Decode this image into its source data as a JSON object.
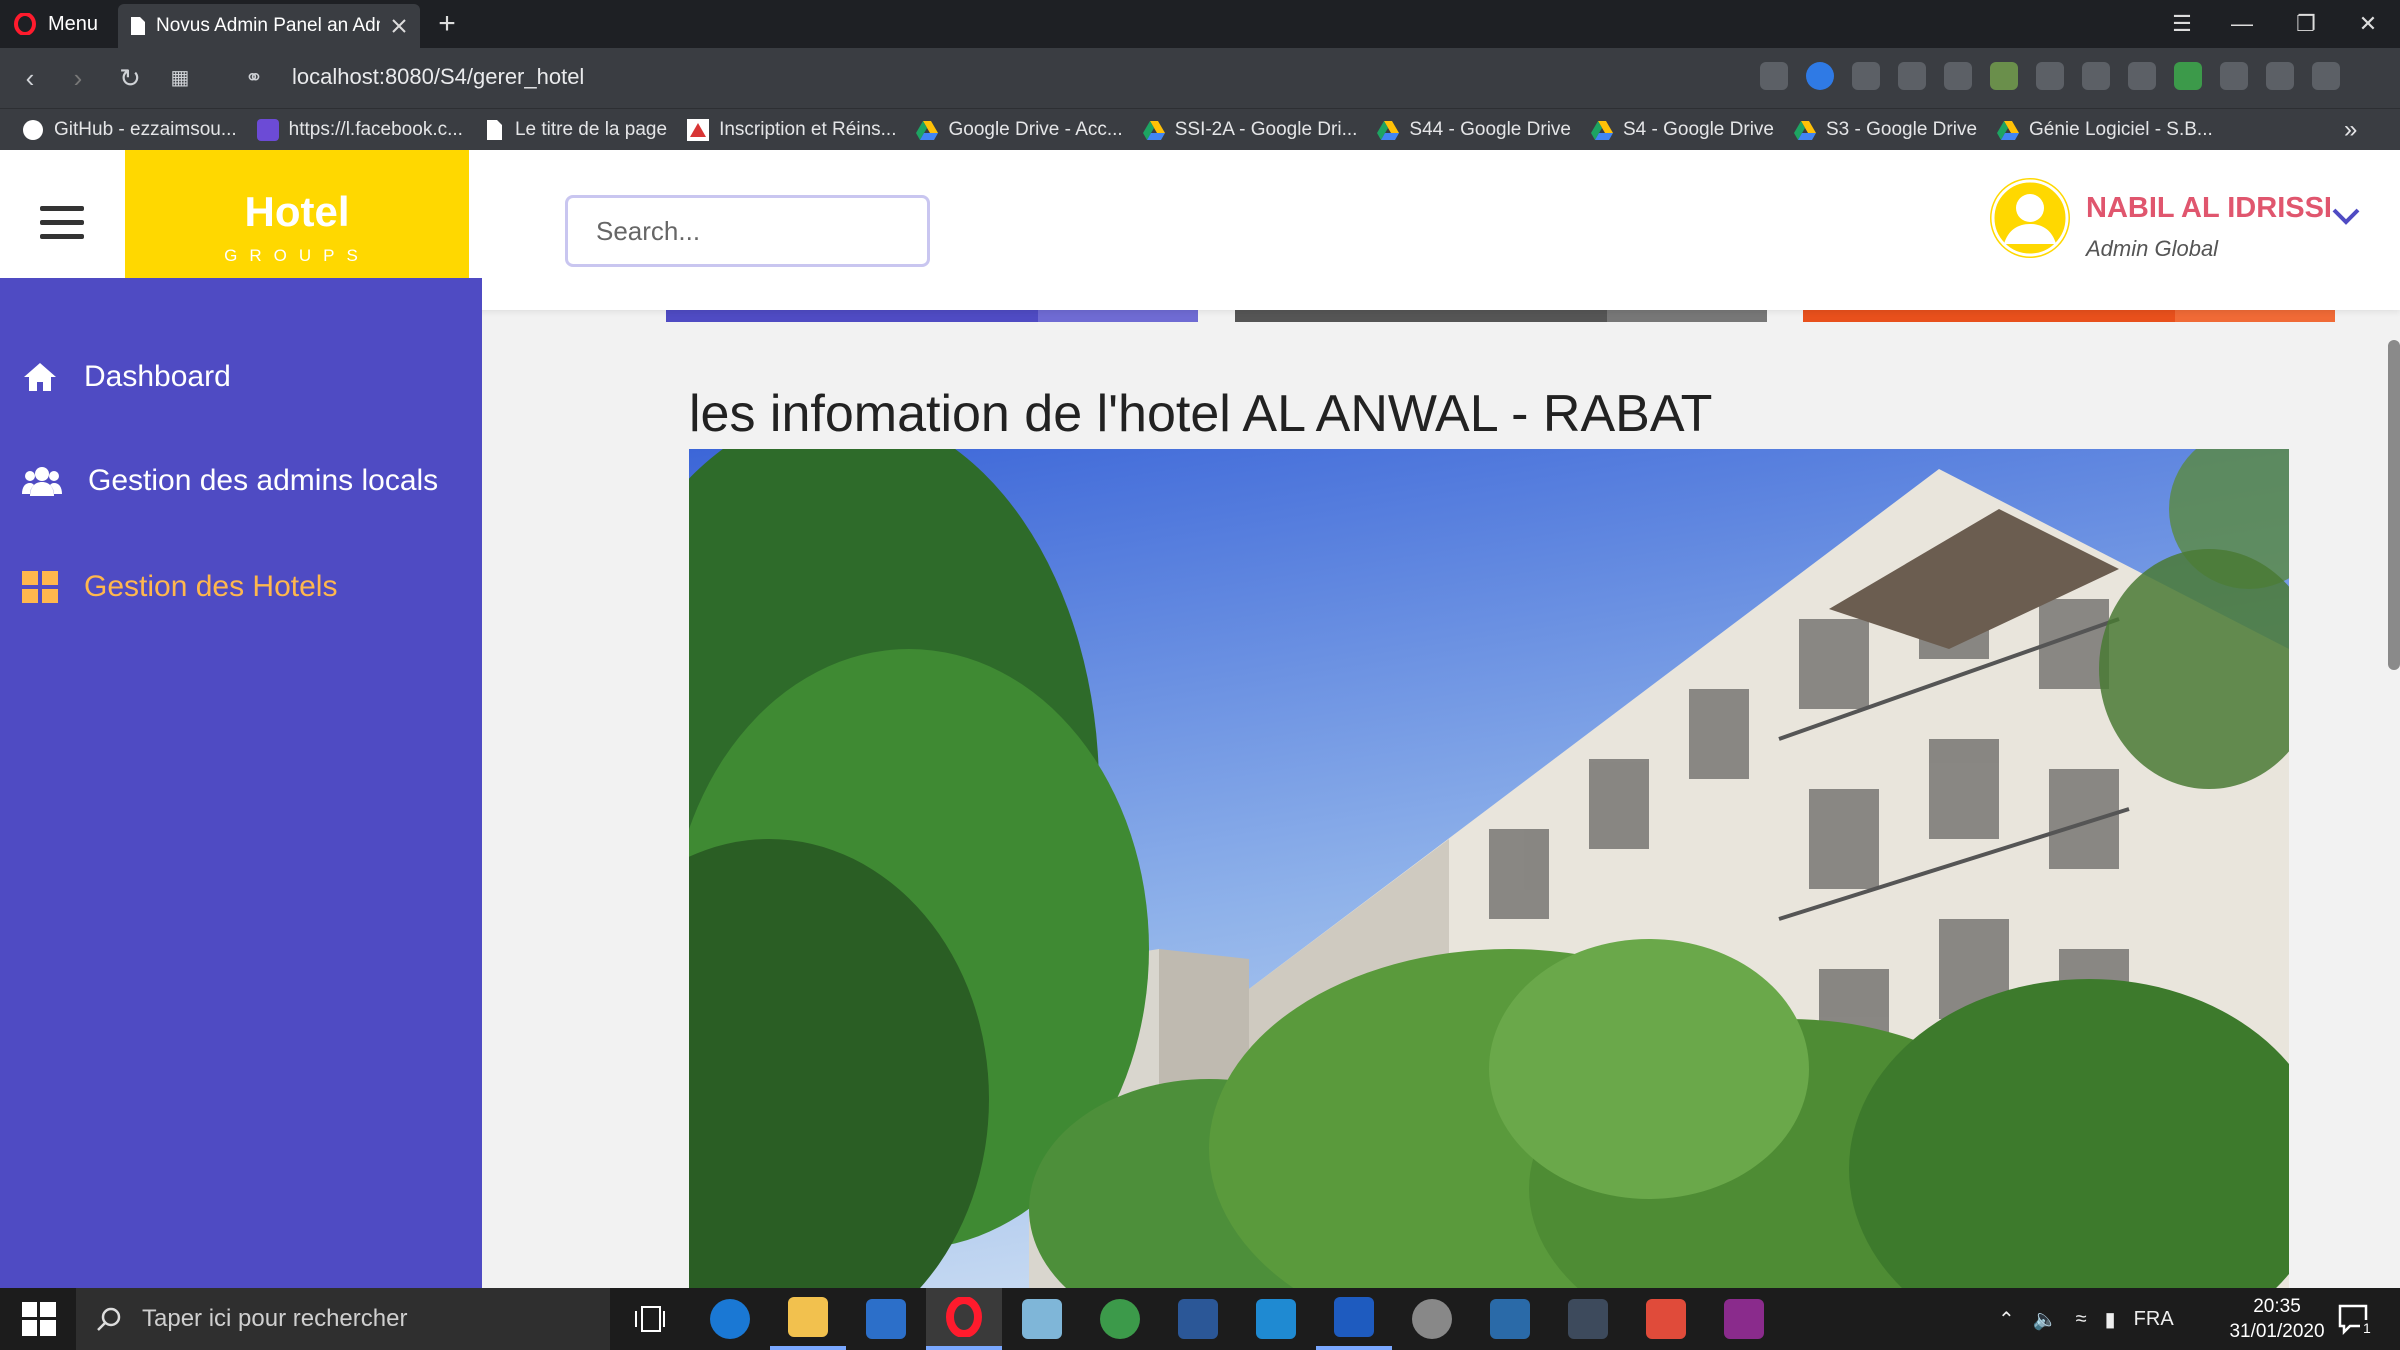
{
  "browser": {
    "menu_label": "Menu",
    "tab_title": "Novus Admin Panel an Adm",
    "url": "localhost:8080/S4/gerer_hotel",
    "bookmarks": [
      {
        "label": "GitHub - ezzaimsou..."
      },
      {
        "label": "https://l.facebook.c..."
      },
      {
        "label": "Le titre de la page"
      },
      {
        "label": "Inscription et Réins..."
      },
      {
        "label": "Google Drive - Acc..."
      },
      {
        "label": "SSI-2A - Google Dri..."
      },
      {
        "label": "S44 - Google Drive"
      },
      {
        "label": "S4 - Google Drive"
      },
      {
        "label": "S3 - Google Drive"
      },
      {
        "label": "Génie Logiciel - S.B..."
      }
    ]
  },
  "header": {
    "logo_title": "Hotel",
    "logo_subtitle": "GROUPS",
    "search_placeholder": "Search...",
    "user_name": "NABIL AL IDRISSI",
    "user_role": "Admin Global"
  },
  "sidebar": {
    "items": [
      {
        "label": "Dashboard",
        "icon": "home-icon",
        "active": false
      },
      {
        "label": "Gestion des admins locals",
        "icon": "users-icon",
        "active": false
      },
      {
        "label": "Gestion des Hotels",
        "icon": "grid-icon",
        "active": true
      }
    ]
  },
  "main": {
    "title": "les infomation de l'hotel AL ANWAL - RABAT",
    "image_alt": "hotel-building-photo",
    "cards": [
      {
        "color": "#4f4bc3",
        "progress": 0.7
      },
      {
        "color": "#555555",
        "progress": 0.7
      },
      {
        "color": "#e8501c",
        "progress": 0.7
      }
    ]
  },
  "taskbar": {
    "search_placeholder": "Taper ici pour rechercher",
    "language": "FRA",
    "time": "20:35",
    "date": "31/01/2020",
    "notification_count": "1"
  },
  "colors": {
    "sidebar": "#4f4bc3",
    "logo": "#ffd800",
    "active_item": "#ffb74d",
    "user_name": "#e0566e"
  }
}
